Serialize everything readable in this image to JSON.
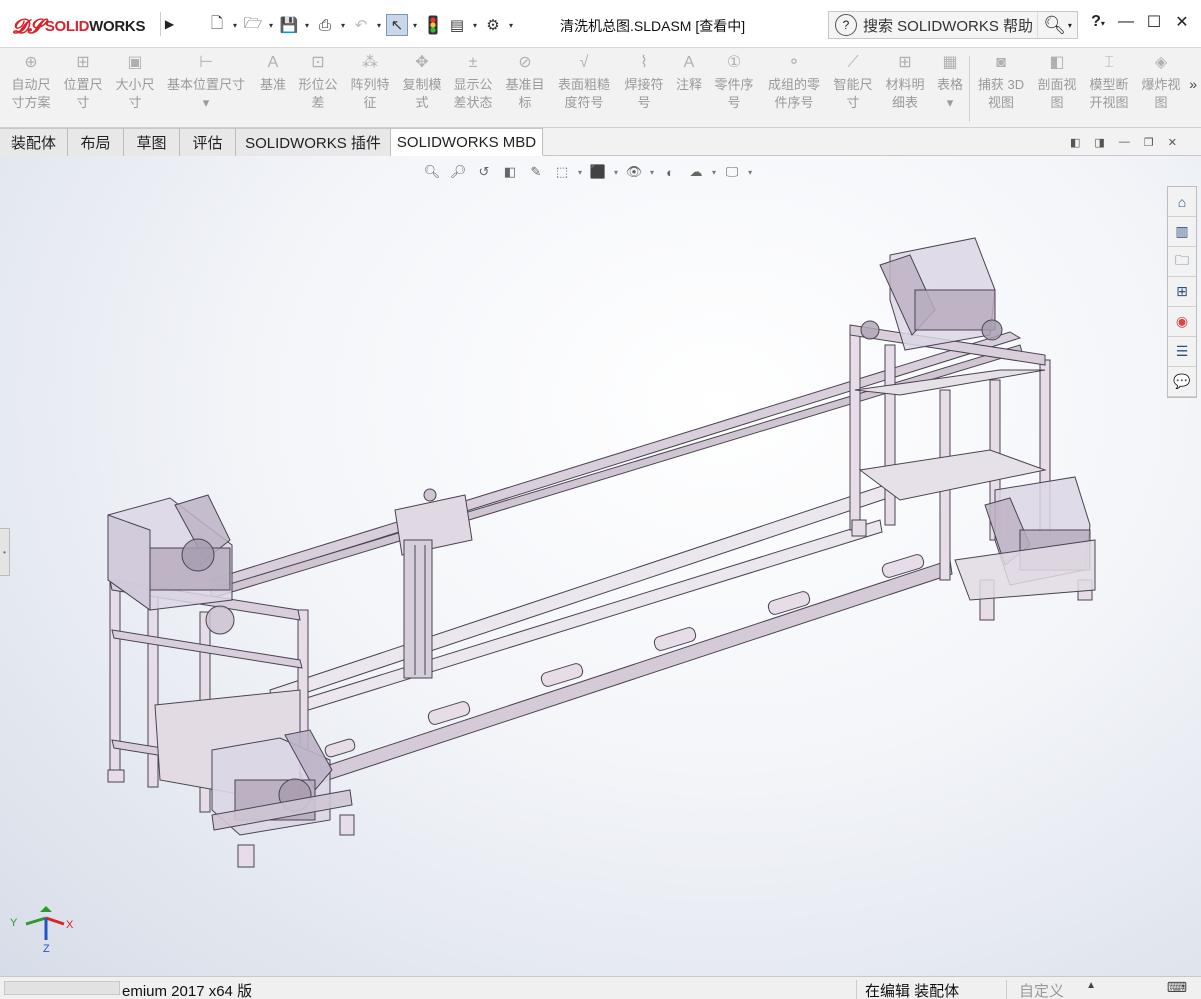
{
  "app": {
    "logo_ds": "𝔇𝔖",
    "logo_text_red": "SOLID",
    "logo_text_dark": "WORKS",
    "document_title": "清洗机总图.SLDASM [查看中]",
    "search_placeholder": "搜索 SOLIDWORKS 帮助",
    "help_label": "?"
  },
  "quick_access": [
    "new-icon",
    "open-icon",
    "save-icon",
    "print-icon",
    "undo-icon",
    "select-icon",
    "rebuild-icon",
    "file-properties-icon",
    "options-icon"
  ],
  "commands": [
    {
      "l1": "自动尺",
      "l2": "寸方案",
      "icon": "auto-dim-icon",
      "glyph": "⊕"
    },
    {
      "l1": "位置尺",
      "l2": "寸",
      "icon": "location-dim-icon",
      "glyph": "⊞"
    },
    {
      "l1": "大小尺",
      "l2": "寸",
      "icon": "size-dim-icon",
      "glyph": "▣"
    },
    {
      "l1": "基本位置尺寸",
      "l2": "▾",
      "icon": "basic-location-dim-icon",
      "glyph": "⊢"
    },
    {
      "l1": "基准",
      "l2": "",
      "icon": "datum-icon",
      "glyph": "A"
    },
    {
      "l1": "形位公",
      "l2": "差",
      "icon": "geometric-tolerance-icon",
      "glyph": "⊡"
    },
    {
      "l1": "阵列特",
      "l2": "征",
      "icon": "pattern-feature-icon",
      "glyph": "⁂"
    },
    {
      "l1": "复制模",
      "l2": "式",
      "icon": "copy-scheme-icon",
      "glyph": "✥"
    },
    {
      "l1": "显示公",
      "l2": "差状态",
      "icon": "tolerance-status-icon",
      "glyph": "±"
    },
    {
      "l1": "基准目",
      "l2": "标",
      "icon": "datum-target-icon",
      "glyph": "⊘"
    },
    {
      "l1": "表面粗糙",
      "l2": "度符号",
      "icon": "surface-finish-icon",
      "glyph": "√"
    },
    {
      "l1": "焊接符",
      "l2": "号",
      "icon": "weld-symbol-icon",
      "glyph": "⌇"
    },
    {
      "l1": "注释",
      "l2": "",
      "icon": "note-icon",
      "glyph": "A"
    },
    {
      "l1": "零件序",
      "l2": "号",
      "icon": "balloon-icon",
      "glyph": "①"
    },
    {
      "l1": "成组的零",
      "l2": "件序号",
      "icon": "stacked-balloon-icon",
      "glyph": "⚬"
    },
    {
      "l1": "智能尺",
      "l2": "寸",
      "icon": "smart-dimension-icon",
      "glyph": "⟋"
    },
    {
      "l1": "材料明",
      "l2": "细表",
      "icon": "bom-icon",
      "glyph": "⊞"
    },
    {
      "l1": "表格",
      "l2": "▾",
      "icon": "table-icon",
      "glyph": "▦"
    },
    {
      "l1": "捕获 3D",
      "l2": "视图",
      "icon": "capture-3d-view-icon",
      "glyph": "◙"
    },
    {
      "l1": "剖面视",
      "l2": "图",
      "icon": "section-view-icon",
      "glyph": "◧"
    },
    {
      "l1": "模型断",
      "l2": "开视图",
      "icon": "model-break-view-icon",
      "glyph": "⌶"
    },
    {
      "l1": "爆炸视",
      "l2": "图",
      "icon": "exploded-view-icon",
      "glyph": "◈"
    }
  ],
  "command_more": "»",
  "tabs": [
    "装配体",
    "布局",
    "草图",
    "评估",
    "SOLIDWORKS 插件",
    "SOLIDWORKS MBD"
  ],
  "active_tab": "SOLIDWORKS MBD",
  "taskpane": [
    "home-icon",
    "design-library-icon",
    "file-explorer-icon",
    "view-palette-icon",
    "appearances-icon",
    "custom-properties-icon",
    "forum-icon"
  ],
  "triad": {
    "x": "X",
    "y": "Y",
    "z": "Z"
  },
  "status": {
    "version": "emium 2017 x64 版",
    "mode": "在编辑 装配体",
    "units": "自定义",
    "units_arrow": "▲"
  }
}
